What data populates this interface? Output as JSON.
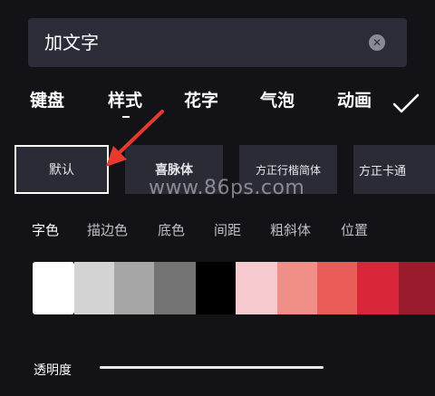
{
  "input": {
    "value": "加文字"
  },
  "tabs": [
    {
      "label": "键盘"
    },
    {
      "label": "样式"
    },
    {
      "label": "花字"
    },
    {
      "label": "气泡"
    },
    {
      "label": "动画"
    }
  ],
  "fonts": [
    {
      "label": "默认"
    },
    {
      "label": "喜脉体"
    },
    {
      "label": "方正行楷简体"
    },
    {
      "label": "方正卡通"
    }
  ],
  "watermark": "www.86ps.com",
  "style_tabs": [
    {
      "label": "字色"
    },
    {
      "label": "描边色"
    },
    {
      "label": "底色"
    },
    {
      "label": "间距"
    },
    {
      "label": "粗斜体"
    },
    {
      "label": "位置"
    }
  ],
  "swatches": [
    "#ffffff",
    "#d3d3d3",
    "#a6a6a6",
    "#737373",
    "#000000",
    "#f6c9cf",
    "#ef8f88",
    "#e95c57",
    "#d9263a",
    "#9a1b2c"
  ],
  "opacity": {
    "label": "透明度"
  },
  "colors": {
    "background": "#121217",
    "panel": "#2c2c38",
    "arrow": "#e8392e"
  }
}
